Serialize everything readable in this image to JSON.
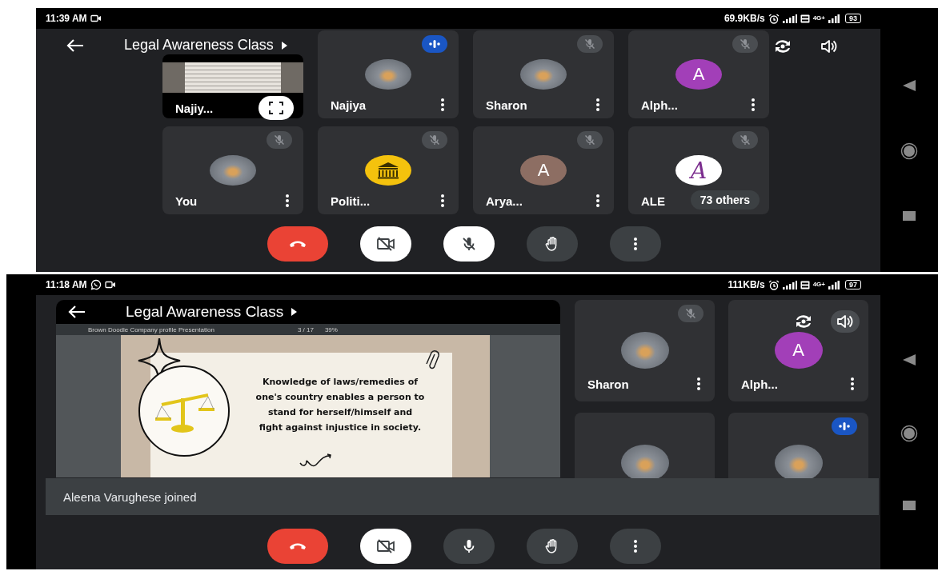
{
  "screens": [
    {
      "status_bar": {
        "time": "11:39 AM",
        "notification_icons": [
          {
            "kind": "video"
          }
        ],
        "speed": "69.9KB/s",
        "network": "4G+",
        "battery": "93"
      },
      "title": "Legal Awareness Class",
      "tiles": [
        {
          "kind": "presentation",
          "name": "Najiy...",
          "muted": false,
          "speaking": false
        },
        {
          "kind": "participant",
          "name": "Najiya",
          "avatar": {
            "kind": "photo"
          },
          "muted": false,
          "speaking": true
        },
        {
          "kind": "participant",
          "name": "Sharon",
          "avatar": {
            "kind": "photo"
          },
          "muted": true,
          "speaking": false
        },
        {
          "kind": "participant",
          "name": "Alph...",
          "avatar": {
            "kind": "letter",
            "letter": "A",
            "color": "#a23fb8"
          },
          "muted": true,
          "speaking": false
        },
        {
          "kind": "participant",
          "name": "You",
          "avatar": {
            "kind": "photo"
          },
          "muted": true,
          "speaking": false
        },
        {
          "kind": "participant",
          "name": "Politi...",
          "avatar": {
            "kind": "building",
            "color": "#f4c20d"
          },
          "muted": true,
          "speaking": false
        },
        {
          "kind": "participant",
          "name": "Arya...",
          "avatar": {
            "kind": "letter",
            "letter": "A",
            "color": "#8d6e63"
          },
          "muted": true,
          "speaking": false
        },
        {
          "kind": "participant",
          "name": "ALE",
          "avatar": {
            "kind": "monogram",
            "letter": "A",
            "color": "#7b2d8e"
          },
          "muted": true,
          "speaking": false,
          "overflow": "73 others"
        }
      ],
      "controls": [
        {
          "kind": "end-call"
        },
        {
          "kind": "camera",
          "off": true
        },
        {
          "kind": "mic",
          "off": true
        },
        {
          "kind": "hand"
        },
        {
          "kind": "more"
        }
      ]
    },
    {
      "status_bar": {
        "time": "11:18 AM",
        "notification_icons": [
          {
            "kind": "whatsapp"
          },
          {
            "kind": "video"
          }
        ],
        "speed": "111KB/s",
        "network": "4G+",
        "battery": "97"
      },
      "title": "Legal Awareness Class",
      "presentation": {
        "document": "Brown Doodle Company profile Presentation",
        "page": "3 / 17",
        "zoom": "39%",
        "text": "Knowledge of laws/remedies of one's country enables a person to stand for herself/himself and fight against injustice in society."
      },
      "tiles": [
        {
          "kind": "participant",
          "name": "Sharon",
          "avatar": {
            "kind": "photo"
          },
          "muted": true,
          "speaking": false
        },
        {
          "kind": "participant",
          "name": "Alph...",
          "avatar": {
            "kind": "letter",
            "letter": "A",
            "color": "#a23fb8"
          },
          "muted": false,
          "speaking": false
        },
        {
          "kind": "participant",
          "avatar": {
            "kind": "photo"
          },
          "muted": false,
          "speaking": false
        },
        {
          "kind": "participant",
          "avatar": {
            "kind": "photo"
          },
          "muted": false,
          "speaking": true
        }
      ],
      "toast": "Aleena Varughese joined",
      "controls": [
        {
          "kind": "end-call"
        },
        {
          "kind": "camera",
          "off": true
        },
        {
          "kind": "mic",
          "off": false
        },
        {
          "kind": "hand"
        },
        {
          "kind": "more"
        }
      ]
    }
  ]
}
